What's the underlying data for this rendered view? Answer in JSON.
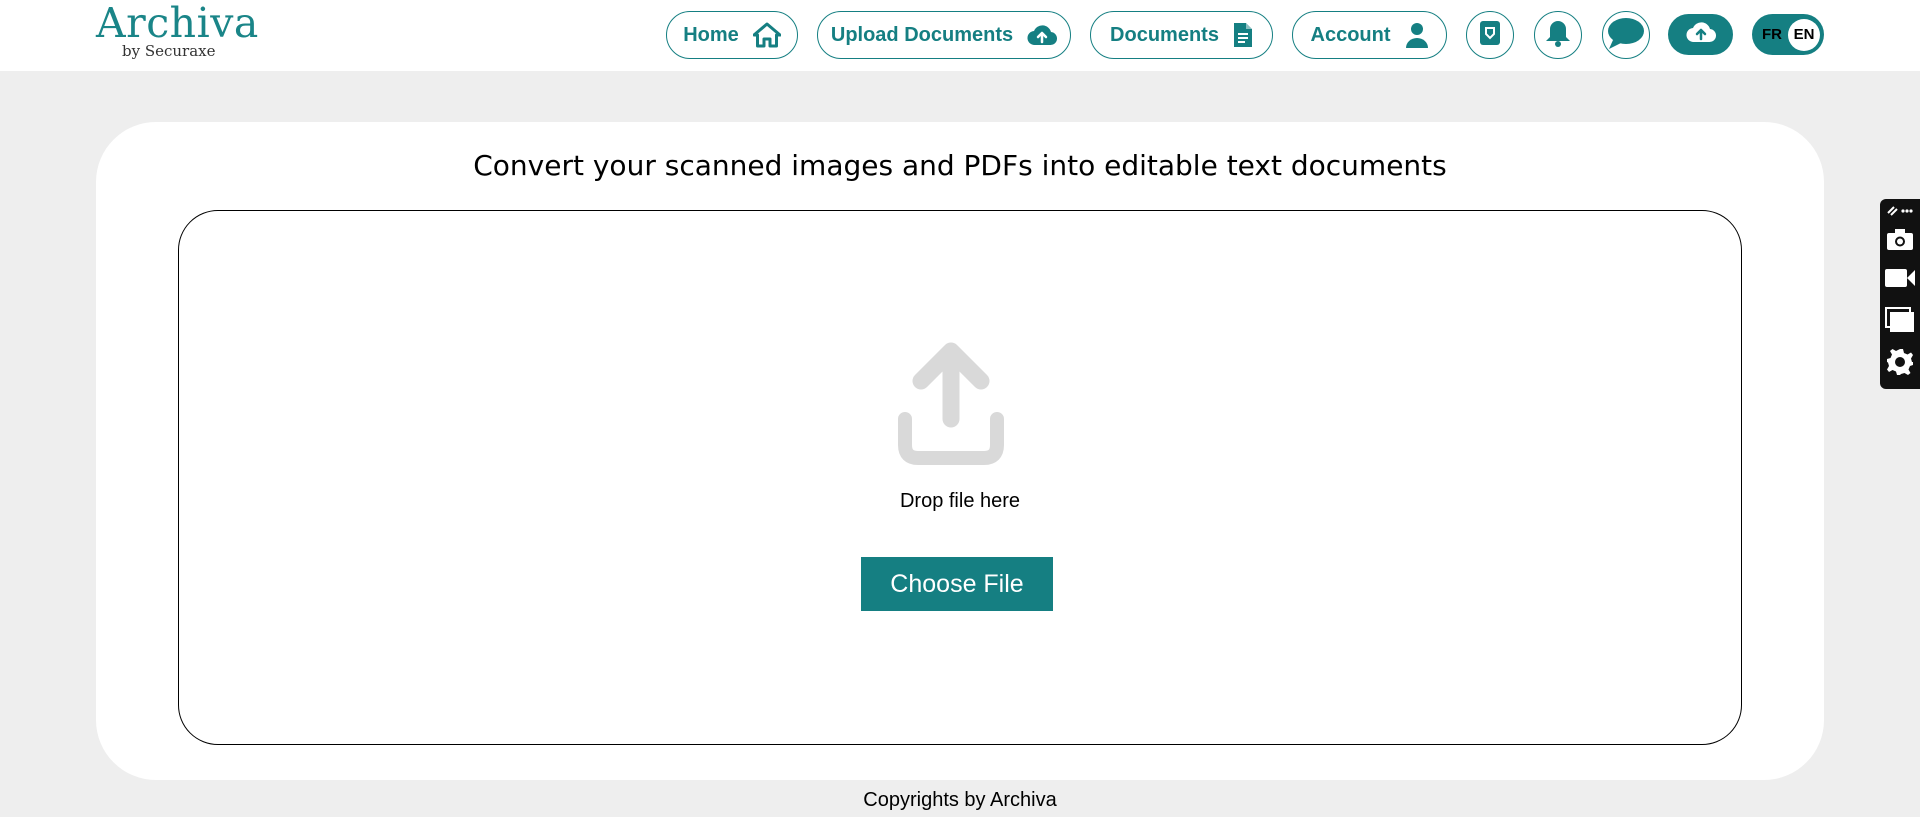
{
  "brand": {
    "name": "Archiva",
    "subtitle": "by Securaxe"
  },
  "nav": {
    "home": "Home",
    "upload": "Upload Documents",
    "documents": "Documents",
    "account": "Account"
  },
  "language": {
    "fr": "FR",
    "en": "EN",
    "selected": "EN"
  },
  "main": {
    "title": "Convert your scanned images and PDFs into editable text documents",
    "drop_text": "Drop file here",
    "choose_label": "Choose File"
  },
  "footer": {
    "text": "Copyrights by Archiva"
  },
  "colors": {
    "accent": "#157f82",
    "background": "#eeeeee",
    "upload_icon": "#d9d9d9"
  },
  "icons": [
    "home-icon",
    "cloud-upload-icon",
    "document-icon",
    "user-icon",
    "shield-icon",
    "bell-icon",
    "chat-icon",
    "camera-icon",
    "video-icon",
    "window-icon",
    "gear-icon"
  ]
}
